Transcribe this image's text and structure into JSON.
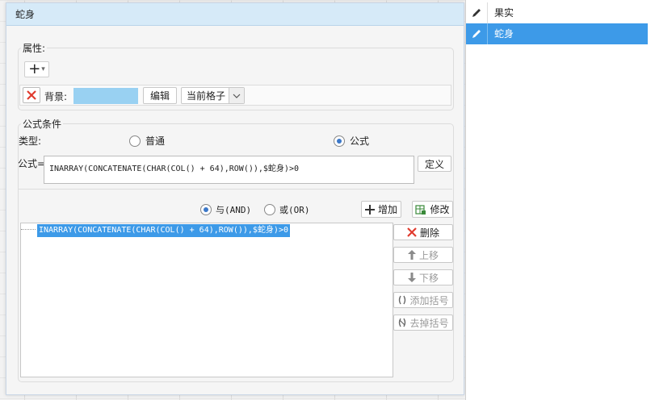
{
  "dialog": {
    "title": "蛇身",
    "attributes": {
      "section_label": "属性:",
      "add_symbol": "+",
      "dropdown_arrow": "▾",
      "background_label": "背景:",
      "background_color": "#99d1f2",
      "edit_button": "编辑",
      "scope_select_value": "当前格子"
    },
    "formula_conditions": {
      "section_label": "公式条件",
      "type_label": "类型:",
      "type_options": [
        "普通",
        "公式"
      ],
      "selected_type": "公式",
      "formula_label": "公式=",
      "formula_value": "INARRAY(CONCATENATE(CHAR(COL() + 64),ROW()),$蛇身)>0",
      "define_button": "定义",
      "logic_options": [
        "与(AND)",
        "或(OR)"
      ],
      "selected_logic": "与(AND)",
      "add_button": "增加",
      "modify_button": "修改",
      "condition_list": [
        "INARRAY(CONCATENATE(CHAR(COL() + 64),ROW()),$蛇身)>0"
      ],
      "side_buttons": {
        "delete": "删除",
        "move_up": "上移",
        "move_down": "下移",
        "add_bracket": "添加括号",
        "remove_bracket": "去掉括号"
      }
    }
  },
  "right_panel": {
    "items": [
      {
        "label": "果实",
        "selected": false
      },
      {
        "label": "蛇身",
        "selected": true
      }
    ],
    "selection_color": "#3d9ae8"
  }
}
